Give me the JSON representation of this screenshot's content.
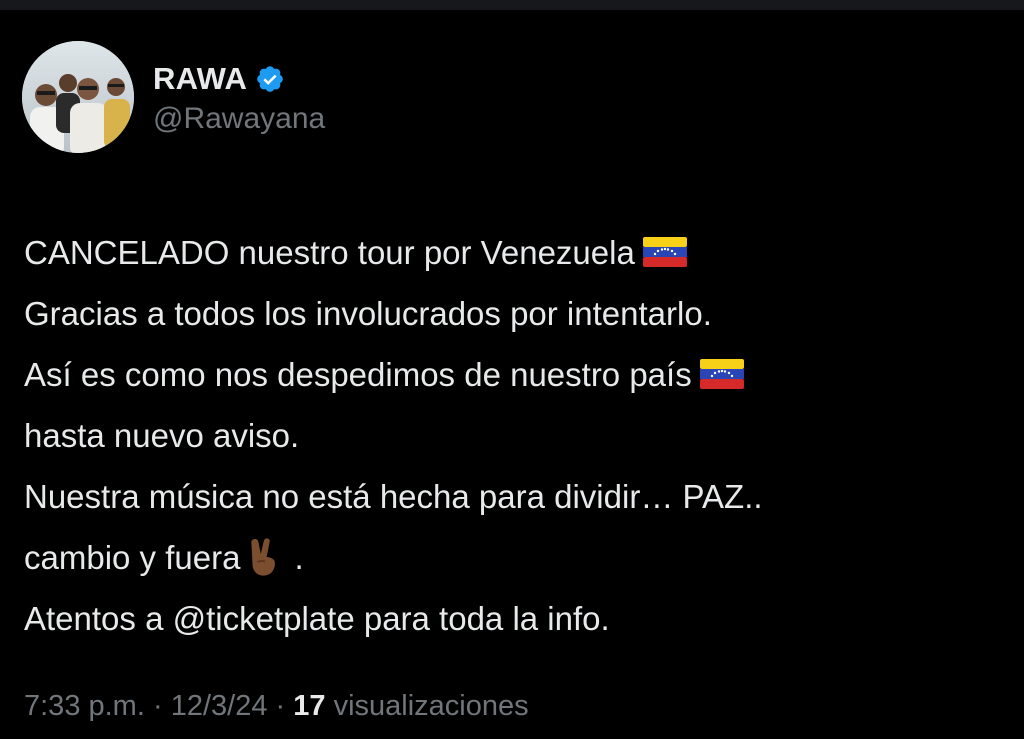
{
  "colors": {
    "background": "#000000",
    "text_primary": "#e7e9ea",
    "text_secondary": "#71767b",
    "verified_badge": "#1d9bf0"
  },
  "author": {
    "display_name": "RAWA",
    "handle": "@Rawayana",
    "verified_icon": "verified-badge-icon",
    "avatar_icon": "profile-photo-avatar"
  },
  "tweet": {
    "lines": [
      {
        "text": "CANCELADO nuestro tour por Venezuela",
        "trailing_icon": "venezuela-flag-icon"
      },
      {
        "text": "Gracias a todos los involucrados por intentarlo."
      },
      {
        "text": "Así es como nos despedimos de nuestro país",
        "trailing_icon": "venezuela-flag-icon"
      },
      {
        "text": "hasta nuevo aviso."
      },
      {
        "text": "Nuestra música no está hecha para dividir… PAZ.."
      },
      {
        "text": "cambio y fuera",
        "trailing_icon": "victory-hand-icon",
        "trailing_text": "."
      },
      {
        "text": "Atentos a @ticketplate para toda la info."
      }
    ]
  },
  "meta": {
    "time": "7:33 p.m.",
    "separator": "·",
    "date": "12/3/24",
    "views_count": "17",
    "views_label": "visualizaciones"
  }
}
